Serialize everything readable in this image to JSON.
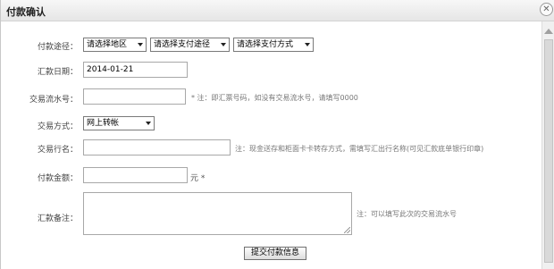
{
  "dialog": {
    "title": "付款确认",
    "close_glyph": "✕"
  },
  "form": {
    "path": {
      "label": "付款途径：",
      "region_select": "请选择地区",
      "route_select": "请选择支付途径",
      "method_select": "请选择支付方式"
    },
    "date": {
      "label": "汇款日期：",
      "value": "2014-01-21"
    },
    "serial": {
      "label": "交易流水号：",
      "value": "",
      "note": "* 注：即汇票号码，如没有交易流水号，请填写0000"
    },
    "trade_type": {
      "label": "交易方式：",
      "selected": "网上转帐"
    },
    "bank": {
      "label": "交易行名：",
      "value": "",
      "note": "注：现金送存和柜面卡卡转存方式，需填写汇出行名称(可见汇款底单银行印章)"
    },
    "amount": {
      "label": "付款金额：",
      "value": "",
      "suffix": "元 *"
    },
    "remark": {
      "label": "汇款备注：",
      "value": "",
      "note": "注：可以填写此次的交易流水号"
    },
    "submit_label": "提交付款信息"
  }
}
